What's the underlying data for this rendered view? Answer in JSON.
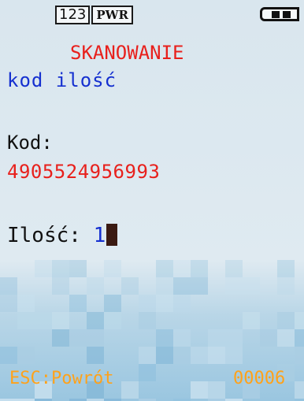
{
  "status": {
    "mode_label": "123",
    "power_label": "PWR"
  },
  "icons": {
    "battery": "battery-icon"
  },
  "screen": {
    "title": "SKANOWANIE",
    "subtitle": "kod ilość",
    "code_label": "Kod:",
    "code_value": "4905524956993",
    "quantity_label": "Ilość:",
    "quantity_value": "1"
  },
  "footer": {
    "esc_label": "ESC:Powrót",
    "counter": "00006"
  },
  "colors": {
    "title": "#e8201c",
    "subtitle": "#1530d0",
    "code_value": "#e8201c",
    "footer": "#ffa21a"
  }
}
